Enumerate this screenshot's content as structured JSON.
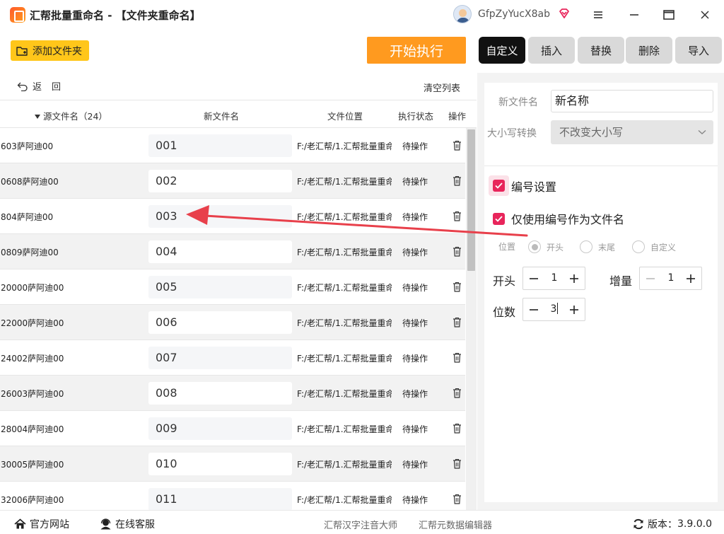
{
  "window": {
    "title": "汇帮批量重命名 - 【文件夹重命名】",
    "user_name": "GfpZyYucX8ab"
  },
  "toolbar": {
    "add_folder_label": "添加文件夹",
    "start_label": "开始执行"
  },
  "tabs": [
    {
      "label": "自定义",
      "active": true
    },
    {
      "label": "插入",
      "active": false
    },
    {
      "label": "替换",
      "active": false
    },
    {
      "label": "删除",
      "active": false
    },
    {
      "label": "导入",
      "active": false
    }
  ],
  "list": {
    "back_label": "返回",
    "clear_label": "清空列表",
    "headers": {
      "source": "源文件名（24）",
      "new_name": "新文件名",
      "location": "文件位置",
      "status": "执行状态",
      "action": "操作"
    },
    "rows": [
      {
        "source": "603萨阿迪00",
        "new_name": "001",
        "location": "F:/老汇帮/1.汇帮批量重命",
        "status": "待操作"
      },
      {
        "source": "0608萨阿迪00",
        "new_name": "002",
        "location": "F:/老汇帮/1.汇帮批量重命",
        "status": "待操作"
      },
      {
        "source": "804萨阿迪00",
        "new_name": "003",
        "location": "F:/老汇帮/1.汇帮批量重命",
        "status": "待操作"
      },
      {
        "source": "0809萨阿迪00",
        "new_name": "004",
        "location": "F:/老汇帮/1.汇帮批量重命",
        "status": "待操作"
      },
      {
        "source": "20000萨阿迪00",
        "new_name": "005",
        "location": "F:/老汇帮/1.汇帮批量重命",
        "status": "待操作"
      },
      {
        "source": "22000萨阿迪00",
        "new_name": "006",
        "location": "F:/老汇帮/1.汇帮批量重命",
        "status": "待操作"
      },
      {
        "source": "24002萨阿迪00",
        "new_name": "007",
        "location": "F:/老汇帮/1.汇帮批量重命",
        "status": "待操作"
      },
      {
        "source": "26003萨阿迪00",
        "new_name": "008",
        "location": "F:/老汇帮/1.汇帮批量重命",
        "status": "待操作"
      },
      {
        "source": "28004萨阿迪00",
        "new_name": "009",
        "location": "F:/老汇帮/1.汇帮批量重命",
        "status": "待操作"
      },
      {
        "source": "30005萨阿迪00",
        "new_name": "010",
        "location": "F:/老汇帮/1.汇帮批量重命",
        "status": "待操作"
      },
      {
        "source": "32006萨阿迪00",
        "new_name": "011",
        "location": "F:/老汇帮/1.汇帮批量重命",
        "status": "待操作"
      }
    ]
  },
  "settings": {
    "new_name_label": "新文件名",
    "new_name_value": "新名称",
    "case_label": "大小写转换",
    "case_value": "不改变大小写",
    "numbering_label": "编号设置",
    "numbering_checked": true,
    "only_number_label": "仅使用编号作为文件名",
    "only_number_checked": true,
    "position_label": "位置",
    "position_options": [
      "开头",
      "末尾",
      "自定义"
    ],
    "position_selected": "开头",
    "start_label": "开头",
    "start_value": "1",
    "increment_label": "增量",
    "increment_value": "1",
    "digits_label": "位数",
    "digits_value": "3"
  },
  "footer": {
    "website_label": "官方网站",
    "support_label": "在线客服",
    "link1": "汇帮汉字注音大师",
    "link2": "汇帮元数据编辑器",
    "version_label": "版本：",
    "version_value": "3.9.0.0"
  },
  "colors": {
    "accent_orange": "#ff9a1f",
    "add_button_yellow": "#ffc61a",
    "checkbox_pink": "#e8255b",
    "annotation_arrow": "#e8404b"
  }
}
